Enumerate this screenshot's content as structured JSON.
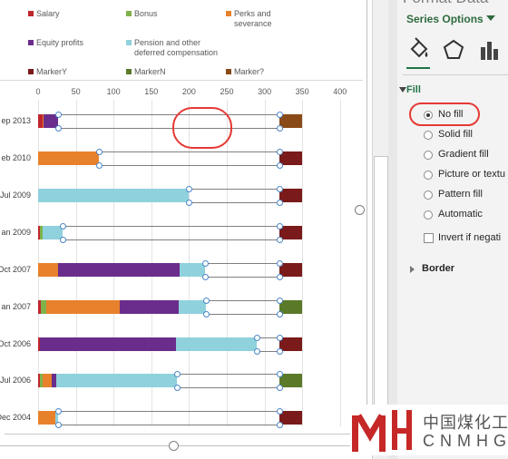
{
  "legend": [
    {
      "label": "Salary",
      "color": "#c0262d"
    },
    {
      "label": "Bonus",
      "color": "#7fb24a"
    },
    {
      "label": "Perks and severance",
      "color": "#e8812c"
    },
    {
      "label": "Equity profits",
      "color": "#6a2d8c"
    },
    {
      "label": "Pension and other deferred compensation",
      "color": "#8fd1dc"
    },
    {
      "label": "MarkerY",
      "color": "#7a1a1a"
    },
    {
      "label": "MarkerN",
      "color": "#5a7a2a"
    },
    {
      "label": "Marker?",
      "color": "#8a4a17"
    }
  ],
  "chart_data": {
    "type": "bar",
    "orientation": "horizontal",
    "stacked": true,
    "xlim": [
      0,
      400
    ],
    "x_ticks": [
      "0",
      "50",
      "100",
      "150",
      "200",
      "250",
      "300",
      "350",
      "400"
    ],
    "grid": true,
    "legend_position": "top",
    "categories": [
      "ep 2013",
      "eb 2010",
      "Jul 2009",
      "an 2009",
      "Oct 2007",
      "an 2007",
      "Oct 2006",
      "Jul 2006",
      "Dec 2004"
    ],
    "series": [
      {
        "name": "Salary",
        "values": [
          6,
          0,
          0,
          3,
          0,
          4,
          2,
          3,
          0
        ]
      },
      {
        "name": "Bonus",
        "values": [
          0,
          0,
          0,
          3,
          0,
          7,
          0,
          3,
          0
        ]
      },
      {
        "name": "Perks and severance",
        "values": [
          1,
          80,
          0,
          0,
          26,
          97,
          0,
          12,
          23
        ]
      },
      {
        "name": "Equity profits",
        "values": [
          19,
          0,
          0,
          0,
          162,
          78,
          181,
          6,
          0
        ]
      },
      {
        "name": "Pension and other deferred compensation",
        "values": [
          0,
          0,
          200,
          27,
          33,
          36,
          107,
          160,
          4
        ]
      },
      {
        "name": "MarkerY",
        "values": [
          0,
          30,
          30,
          30,
          30,
          0,
          30,
          0,
          30
        ]
      },
      {
        "name": "MarkerN",
        "values": [
          0,
          0,
          0,
          0,
          0,
          30,
          0,
          30,
          0
        ]
      },
      {
        "name": "Marker?",
        "values": [
          30,
          0,
          0,
          0,
          0,
          0,
          0,
          0,
          0
        ]
      }
    ],
    "marker_start": 320
  },
  "scroll": {
    "thumb_fraction": 0.65
  },
  "pane": {
    "title": "Format Data",
    "series_options": "Series Options",
    "tab_icons": [
      "fill-bucket-icon",
      "pentagon-effects-icon",
      "bar-chart-options-icon"
    ],
    "fill_header": "Fill",
    "fill_options": [
      {
        "label": "No fill",
        "selected": true,
        "name": "no-fill"
      },
      {
        "label": "Solid fill",
        "selected": false,
        "name": "solid-fill"
      },
      {
        "label": "Gradient fill",
        "selected": false,
        "name": "gradient-fill"
      },
      {
        "label": "Picture or textu",
        "selected": false,
        "name": "picture-fill"
      },
      {
        "label": "Pattern fill",
        "selected": false,
        "name": "pattern-fill"
      },
      {
        "label": "Automatic",
        "selected": false,
        "name": "automatic-fill"
      }
    ],
    "invert_label": "Invert if negati",
    "border_header": "Border"
  },
  "watermark": {
    "cn": "中国煤化工",
    "en": "CNMHG"
  }
}
